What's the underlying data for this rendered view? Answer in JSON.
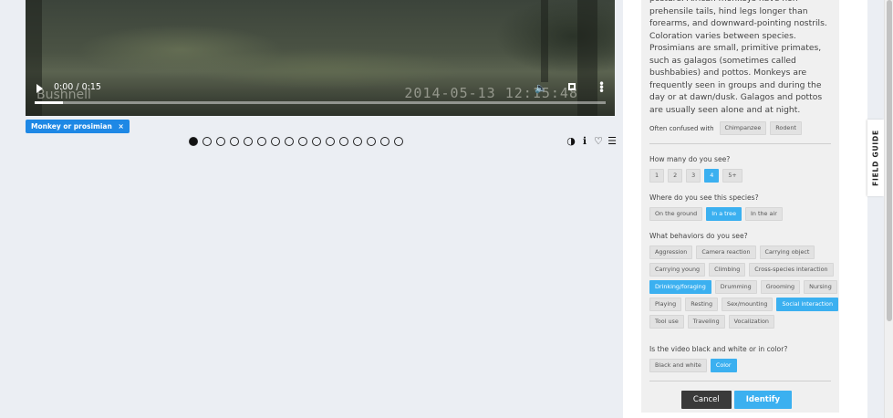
{
  "video": {
    "time": "0:00 / 0:15",
    "timestamp_overlay": "2014-05-13  12:15:48",
    "watermark": "Bushnell",
    "progress_fraction": 0.05
  },
  "selected_tag": {
    "label": "Monkey or prosimian",
    "remove": "×"
  },
  "subject_dots": {
    "count": 16,
    "active_index": 0
  },
  "tools": [
    {
      "icon": "contrast-icon",
      "glyph": "◑"
    },
    {
      "icon": "info-icon",
      "glyph": "ℹ"
    },
    {
      "icon": "heart-icon",
      "glyph": "♡"
    },
    {
      "icon": "list-icon",
      "glyph": "☰"
    }
  ],
  "panel": {
    "description": "posture. African monkeys have non-prehensile tails, hind legs longer than forearms, and downward-pointing nostrils. Coloration varies between species. Prosimians are small, primitive primates, such as galagos (sometimes called bushbabies) and pottos. Monkeys are frequently seen in groups and during the day or at dawn/dusk. Galagos and pottos are usually seen alone and at night.",
    "confused_label": "Often confused with",
    "confused_with": [
      "Chimpanzee",
      "Rodent"
    ],
    "how_many": {
      "question": "How many do you see?",
      "options": [
        {
          "label": "1",
          "selected": false
        },
        {
          "label": "2",
          "selected": false
        },
        {
          "label": "3",
          "selected": false
        },
        {
          "label": "4",
          "selected": true
        },
        {
          "label": "5+",
          "selected": false
        }
      ]
    },
    "where": {
      "question": "Where do you see this species?",
      "options": [
        {
          "label": "On the ground",
          "selected": false
        },
        {
          "label": "In a tree",
          "selected": true
        },
        {
          "label": "In the air",
          "selected": false
        }
      ]
    },
    "behaviors": {
      "question": "What behaviors do you see?",
      "rows": [
        [
          {
            "label": "Aggression",
            "selected": false
          },
          {
            "label": "Camera reaction",
            "selected": false
          },
          {
            "label": "Carrying object",
            "selected": false
          }
        ],
        [
          {
            "label": "Carrying young",
            "selected": false
          },
          {
            "label": "Climbing",
            "selected": false
          },
          {
            "label": "Cross-species interaction",
            "selected": false
          }
        ],
        [
          {
            "label": "Drinking/foraging",
            "selected": true
          },
          {
            "label": "Drumming",
            "selected": false
          },
          {
            "label": "Grooming",
            "selected": false
          },
          {
            "label": "Nursing",
            "selected": false
          }
        ],
        [
          {
            "label": "Playing",
            "selected": false
          },
          {
            "label": "Resting",
            "selected": false
          },
          {
            "label": "Sex/mounting",
            "selected": false
          },
          {
            "label": "Social interaction",
            "selected": true
          }
        ],
        [
          {
            "label": "Tool use",
            "selected": false
          },
          {
            "label": "Traveling",
            "selected": false
          },
          {
            "label": "Vocalization",
            "selected": false
          }
        ]
      ]
    },
    "color": {
      "question": "Is the video black and white or in color?",
      "options": [
        {
          "label": "Black and white",
          "selected": false
        },
        {
          "label": "Color",
          "selected": true
        }
      ]
    },
    "cancel_label": "Cancel",
    "identify_label": "Identify"
  },
  "field_guide_label": "FIELD GUIDE",
  "colors": {
    "accent": "#3bb0f0",
    "tag": "#1e88e5",
    "cancel": "#3a3a3a"
  }
}
